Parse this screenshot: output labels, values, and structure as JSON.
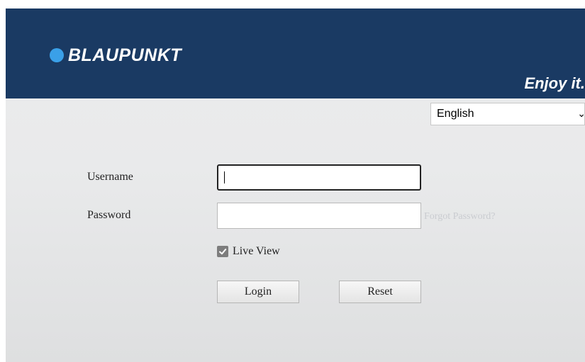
{
  "header": {
    "brand": "BLAUPUNKT",
    "slogan": "Enjoy it.",
    "logo_icon": "blue-dot-icon",
    "background_color": "#1a3a63",
    "dot_color": "#3aa0e8"
  },
  "language": {
    "selected": "English",
    "chevron_icon": "chevron-down-icon"
  },
  "form": {
    "username_label": "Username",
    "username_value": "",
    "password_label": "Password",
    "password_value": "",
    "forgot_password": "Forgot Password?",
    "live_view_label": "Live View",
    "live_view_checked": true,
    "login_label": "Login",
    "reset_label": "Reset"
  }
}
